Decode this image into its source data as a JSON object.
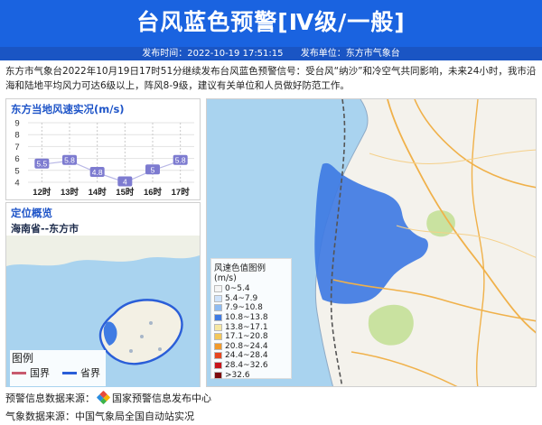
{
  "header": {
    "title": "台风蓝色预警[Ⅳ级/一般]",
    "publish_time_label": "发布时间：2022-10-19 17:51:15",
    "publisher_label": "发布单位：东方市气象台"
  },
  "description": "东方市气象台2022年10月19日17时51分继续发布台风蓝色预警信号：受台风“纳沙”和冷空气共同影响，未来24小时，我市沿海和陆地平均风力可达6级以上，阵风8-9级，建议有关单位和人员做好防范工作。",
  "wind_panel": {
    "title": "东方当地风速实况(m/s)",
    "y_ticks": [
      "9",
      "8",
      "7",
      "6",
      "5",
      "4"
    ]
  },
  "chart_data": {
    "type": "line",
    "title": "东方当地风速实况(m/s)",
    "categories": [
      "12时",
      "13时",
      "14时",
      "15时",
      "16时",
      "17时"
    ],
    "values": [
      5.5,
      5.8,
      4.8,
      4,
      5,
      5.8
    ],
    "value_labels": [
      "5.5",
      "5.8",
      "4.8",
      "4",
      "5",
      "5.8"
    ],
    "ylim": [
      4,
      9
    ],
    "xlabel": "",
    "ylabel": "",
    "grid": true,
    "color": "#7d7bd0"
  },
  "location_panel": {
    "title": "定位概览",
    "region": "海南省--东方市",
    "legend_title": "图例",
    "legend_items": [
      {
        "label": "国界",
        "color": "#c85a6e"
      },
      {
        "label": "省界",
        "color": "#2a5ed8"
      }
    ]
  },
  "color_legend": {
    "title": "风速色值图例 (m/s)",
    "items": [
      {
        "label": "0~5.4",
        "color": "#f5f5f5"
      },
      {
        "label": "5.4~7.9",
        "color": "#cfe3fb"
      },
      {
        "label": "7.9~10.8",
        "color": "#8fbcf2"
      },
      {
        "label": "10.8~13.8",
        "color": "#3f7be3"
      },
      {
        "label": "13.8~17.1",
        "color": "#f6e7a2"
      },
      {
        "label": "17.1~20.8",
        "color": "#f3c75a"
      },
      {
        "label": "20.8~24.4",
        "color": "#f19a2b"
      },
      {
        "label": "24.4~28.4",
        "color": "#e6451f"
      },
      {
        "label": "28.4~32.6",
        "color": "#c8151b"
      },
      {
        "label": ">32.6",
        "color": "#7e0a0d"
      }
    ]
  },
  "footer": {
    "warning_source_label": "预警信息数据来源：",
    "warning_source_name": "国家预警信息发布中心",
    "weather_source_label": "气象数据来源：",
    "weather_source_name": "中国气象局全国自动站实况"
  },
  "colors": {
    "header_bg": "#1a63e0",
    "accent": "#1f55c8",
    "wind_area": "#3f7be3"
  }
}
